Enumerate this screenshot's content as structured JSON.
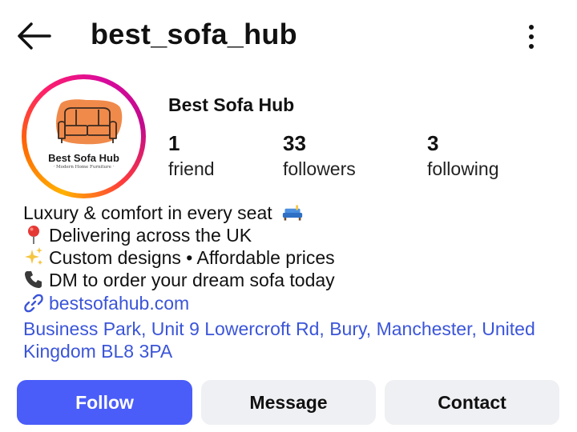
{
  "header": {
    "username": "best_sofa_hub",
    "back_icon": "arrow-left-icon",
    "more_icon": "more-vertical-icon"
  },
  "profile": {
    "display_name": "Best Sofa Hub",
    "avatar": {
      "logo_text": "Best Sofa Hub",
      "logo_subtext": "· Modern Home Furniture ·"
    },
    "stats": [
      {
        "value": "1",
        "label": "friend"
      },
      {
        "value": "33",
        "label": "followers"
      },
      {
        "value": "3",
        "label": "following"
      }
    ]
  },
  "bio": {
    "lines": [
      {
        "text": "Luxury & comfort in every seat",
        "emoji": "sofa-emoji",
        "emoji_position": "after"
      },
      {
        "text": "Delivering across the UK",
        "emoji": "round-pushpin-emoji",
        "emoji_position": "before"
      },
      {
        "text": "Custom designs • Affordable prices",
        "emoji": "sparkles-emoji",
        "emoji_position": "before"
      },
      {
        "text": "DM to order your dream sofa today",
        "emoji": "telephone-receiver-emoji",
        "emoji_position": "before"
      }
    ],
    "link": {
      "text": "bestsofahub.com",
      "icon": "link-icon"
    },
    "address": "Business Park, Unit 9 Lowercroft Rd, Bury, Manchester, United Kingdom BL8 3PA"
  },
  "actions": {
    "follow_label": "Follow",
    "message_label": "Message",
    "contact_label": "Contact"
  },
  "colors": {
    "accent_button": "#4a5df9",
    "link": "#3b55d9",
    "secondary_button": "#eff0f3",
    "story_ring": [
      "#ffb100",
      "#ff1f6b",
      "#c20a8d"
    ],
    "logo_sofa": "#f08a4b"
  }
}
